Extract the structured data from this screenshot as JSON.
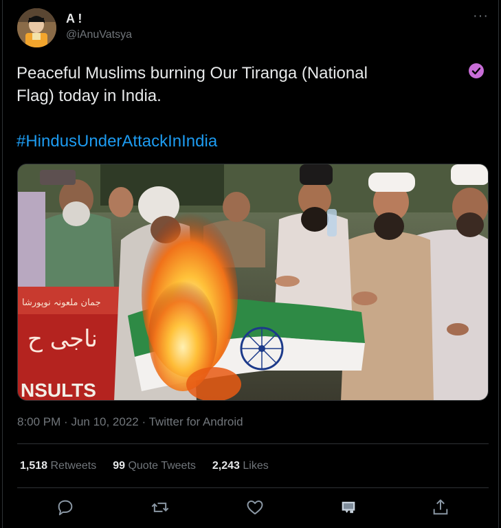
{
  "author": {
    "display_name": "A !",
    "handle": "@iAnuVatsya"
  },
  "tweet": {
    "text_line1": "Peaceful Muslims burning Our Tiranga (National",
    "text_line2": "Flag) today in India.",
    "hashtag": "#HindusUnderAttackInIndia",
    "time": "8:00 PM",
    "date": "Jun 10, 2022",
    "source": "Twitter for Android"
  },
  "banner_text": {
    "urdu_top": "جمان ملعونہ نوپورشا",
    "urdu_mid": "ناجی ح",
    "english": "NSULTS"
  },
  "stats": {
    "retweets_count": "1,518",
    "retweets_label": "Retweets",
    "quotes_count": "99",
    "quotes_label": "Quote Tweets",
    "likes_count": "2,243",
    "likes_label": "Likes"
  },
  "icons": {
    "more": "more-icon",
    "verified": "verified-badge-icon",
    "reply": "reply-icon",
    "retweet": "retweet-icon",
    "like": "like-icon",
    "bookmark": "bookmark-icon",
    "share": "share-icon"
  },
  "colors": {
    "background": "#000000",
    "text": "#e7e9ea",
    "muted": "#71767b",
    "link": "#1d9bf0",
    "verified": "#c86dd7"
  }
}
